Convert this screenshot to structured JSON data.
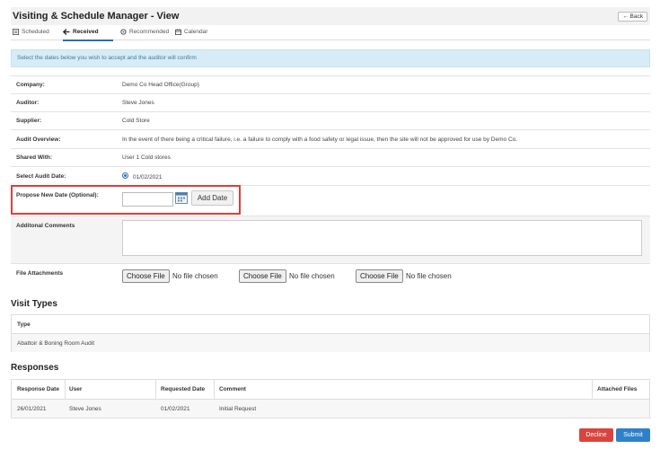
{
  "header": {
    "title": "Visiting & Schedule Manager - View",
    "back_label": "← Back"
  },
  "tabs": [
    {
      "label": "Scheduled",
      "icon": "calendar-list-icon"
    },
    {
      "label": "Received",
      "icon": "arrow-left-icon",
      "active": true
    },
    {
      "label": "Recommended",
      "icon": "circle-icon"
    },
    {
      "label": "Calendar",
      "icon": "calendar-icon"
    }
  ],
  "alert": "Select the dates below you wish to accept and the auditor will confirm",
  "details": {
    "company": {
      "label": "Company:",
      "value": "Demo Co Head Office(Group)"
    },
    "auditor": {
      "label": "Auditor:",
      "value": "Steve Jones"
    },
    "supplier": {
      "label": "Supplier:",
      "value": "Cold Store"
    },
    "overview": {
      "label": "Audit Overview:",
      "value": "In the event of there being a critical failure, i.e. a failure to comply with a food safety or legal issue, then the site will not be approved for use by Demo Co."
    },
    "shared": {
      "label": "Shared With:",
      "value": "User 1 Cold stores"
    },
    "audit_date": {
      "label": "Select Audit Date:",
      "value": "01/02/2021"
    },
    "propose": {
      "label": "Propose New Date (Optional):",
      "add_label": "Add Date"
    },
    "comments": {
      "label": "Additonal Comments"
    },
    "files": {
      "label": "File Attachments",
      "button_label": "Choose File",
      "status": "No file chosen"
    }
  },
  "visit_types": {
    "title": "Visit Types",
    "header": "Type",
    "rows": [
      "Abattoir & Boning Room Audit"
    ]
  },
  "responses": {
    "title": "Responses",
    "headers": [
      "Response Date",
      "User",
      "Requested Date",
      "Comment",
      "Attached Files"
    ],
    "rows": [
      [
        "26/01/2021",
        "Steve Jones",
        "01/02/2021",
        "Initial Request",
        ""
      ]
    ]
  },
  "actions": {
    "decline": "Decline",
    "submit": "Submit"
  },
  "colors": {
    "accent": "#2f80c8",
    "danger": "#d9453e",
    "alert_bg": "#d7ecf6",
    "highlight": "#d9403e"
  }
}
